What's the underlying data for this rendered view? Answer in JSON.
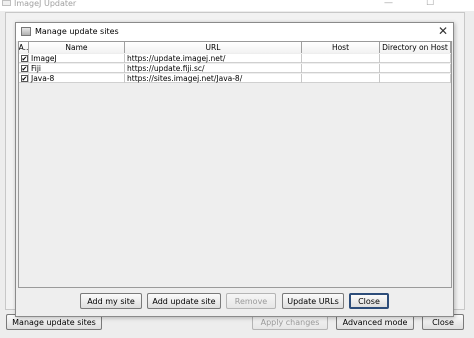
{
  "outer_window": {
    "title": "ImageJ Updater",
    "maximize_glyph": "☐",
    "minimize_glyph": "—",
    "buttons": {
      "manage_update_sites": "Manage update sites",
      "apply_changes": "Apply changes",
      "advanced_mode": "Advanced mode",
      "close": "Close"
    }
  },
  "dialog": {
    "title": "Manage update sites",
    "close_glyph": "✕",
    "table": {
      "columns": [
        "A..",
        "Name",
        "URL",
        "Host",
        "Directory on Host"
      ],
      "rows": [
        {
          "active": "✔",
          "name": "ImageJ",
          "url": "https://update.imagej.net/",
          "host": "",
          "directory": ""
        },
        {
          "active": "✔",
          "name": "Fiji",
          "url": "https://update.fiji.sc/",
          "host": "",
          "directory": ""
        },
        {
          "active": "✔",
          "name": "Java-8",
          "url": "https://sites.imagej.net/Java-8/",
          "host": "",
          "directory": ""
        }
      ]
    },
    "buttons": {
      "add_my_site": "Add my site",
      "add_update_site": "Add update site",
      "remove": "Remove",
      "update_urls": "Update URLs",
      "close": "Close"
    }
  }
}
